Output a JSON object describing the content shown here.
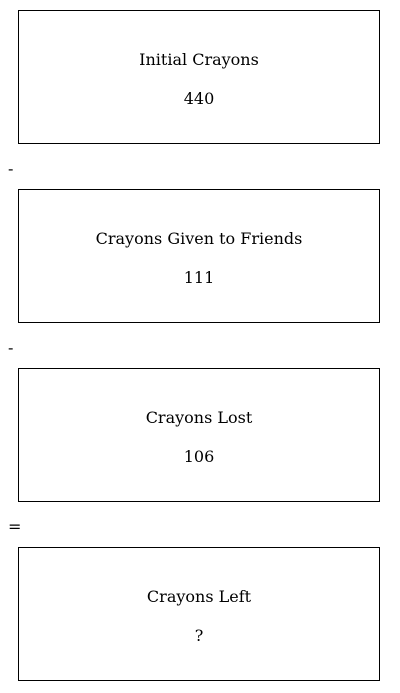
{
  "boxes": [
    {
      "label": "Initial Crayons",
      "value": "440"
    },
    {
      "label": "Crayons Given to Friends",
      "value": "111"
    },
    {
      "label": "Crayons Lost",
      "value": "106"
    },
    {
      "label": "Crayons Left",
      "value": "?"
    }
  ],
  "operators": [
    "-",
    "-",
    "="
  ]
}
